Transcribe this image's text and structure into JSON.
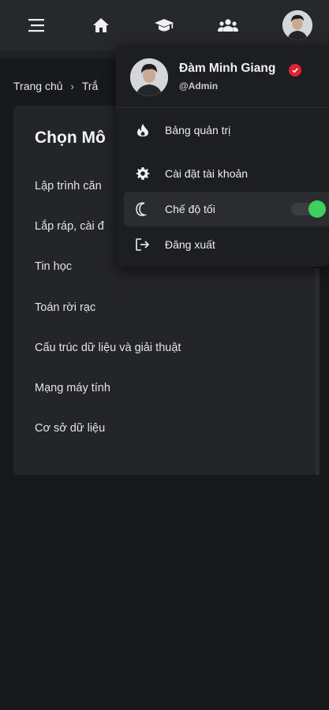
{
  "nav": {
    "menu_icon": "hamburger-menu-icon",
    "home_icon": "home-icon",
    "courses_icon": "graduation-cap-icon",
    "community_icon": "users-icon",
    "avatar_icon": "user-avatar"
  },
  "breadcrumb": {
    "home": "Trang chủ",
    "separator": "›",
    "current": "Trắ"
  },
  "card": {
    "title": "Chọn Mô",
    "subjects": [
      "Lập trình căn",
      "Lắp ráp, cài đ",
      "Tin học",
      "Toán rời rạc",
      "Cấu trúc dữ liệu và giải thuật",
      "Mạng máy tính",
      "Cơ sở dữ liệu"
    ]
  },
  "profile_menu": {
    "name": "Đàm Minh Giang",
    "handle": "@Admin",
    "verified_color": "#e2222e",
    "items": [
      {
        "label": "Bảng quản trị",
        "icon": "fire-icon"
      },
      {
        "label": "Cài đặt tài khoản",
        "icon": "gear-icon"
      },
      {
        "label": "Chế độ tối",
        "icon": "moon-icon",
        "toggle_on": true
      },
      {
        "label": "Đăng xuất",
        "icon": "logout-icon"
      }
    ]
  },
  "colors": {
    "background": "#18191b",
    "topbar": "#27282b",
    "card": "#242528",
    "dropdown": "#1d1e21",
    "toggle_on": "#3dd05c"
  }
}
